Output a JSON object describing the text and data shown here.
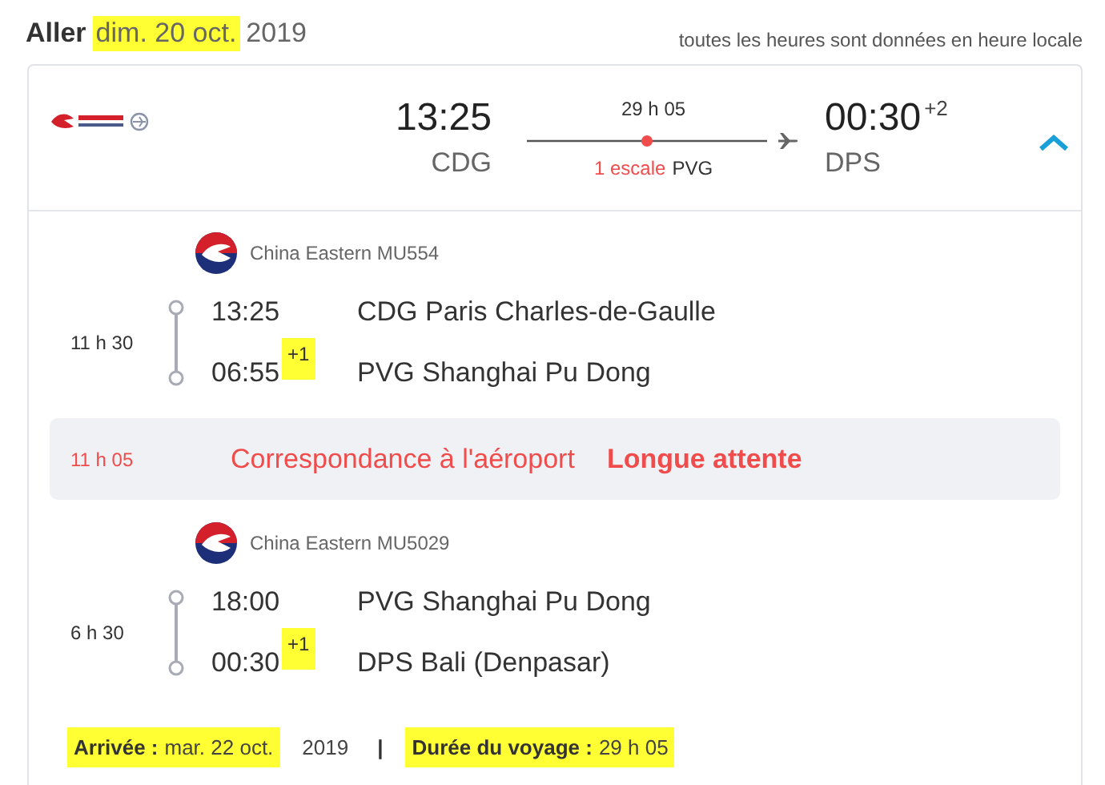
{
  "header": {
    "title": [
      {
        "highlighted": false,
        "parts": [
          {
            "text": "Aller",
            "bold": true
          }
        ]
      },
      {
        "highlighted": true,
        "parts": [
          {
            "text": "dim. 20 oct.",
            "bold": false
          }
        ]
      },
      {
        "highlighted": false,
        "parts": [
          {
            "text": "2019",
            "bold": false
          }
        ]
      }
    ],
    "note": "toutes les heures sont données en heure locale"
  },
  "summary": {
    "departure": {
      "time": "13:25",
      "airport": "CDG"
    },
    "duration": "29 h 05",
    "stops": "1 escale",
    "stop_airport": "PVG",
    "arrival": {
      "time": "00:30",
      "day_offset": "+2",
      "airport": "DPS"
    },
    "expanded": true
  },
  "legs": [
    {
      "kind": "flight",
      "airline": "China Eastern MU554",
      "duration": "11 h 30",
      "points": [
        {
          "time": "13:25",
          "place": "CDG Paris Charles-de-Gaulle"
        },
        {
          "time": "06:55",
          "day_offset": "+1",
          "offset_highlighted": true,
          "place": "PVG Shanghai Pu Dong"
        }
      ]
    },
    {
      "kind": "connection",
      "duration": "11 h 05",
      "label": "Correspondance à l'aéroport",
      "warning": "Longue attente"
    },
    {
      "kind": "flight",
      "airline": "China Eastern MU5029",
      "duration": "6 h 30",
      "points": [
        {
          "time": "18:00",
          "place": "PVG Shanghai Pu Dong"
        },
        {
          "time": "00:30",
          "day_offset": "+1",
          "offset_highlighted": true,
          "place": "DPS Bali (Denpasar)"
        }
      ]
    }
  ],
  "footer": {
    "groups": [
      {
        "highlighted": true,
        "parts": [
          {
            "text": "Arrivée :",
            "bold": true
          },
          {
            "text": "mar. 22 oct.",
            "bold": false
          }
        ]
      },
      {
        "highlighted": false,
        "parts": [
          {
            "text": "2019",
            "bold": false
          }
        ]
      },
      {
        "highlighted": false,
        "parts": [
          {
            "text": "|",
            "bold": true
          }
        ]
      },
      {
        "highlighted": true,
        "parts": [
          {
            "text": "Durée du voyage :",
            "bold": true
          },
          {
            "text": "29 h 05",
            "bold": false
          }
        ]
      }
    ]
  }
}
